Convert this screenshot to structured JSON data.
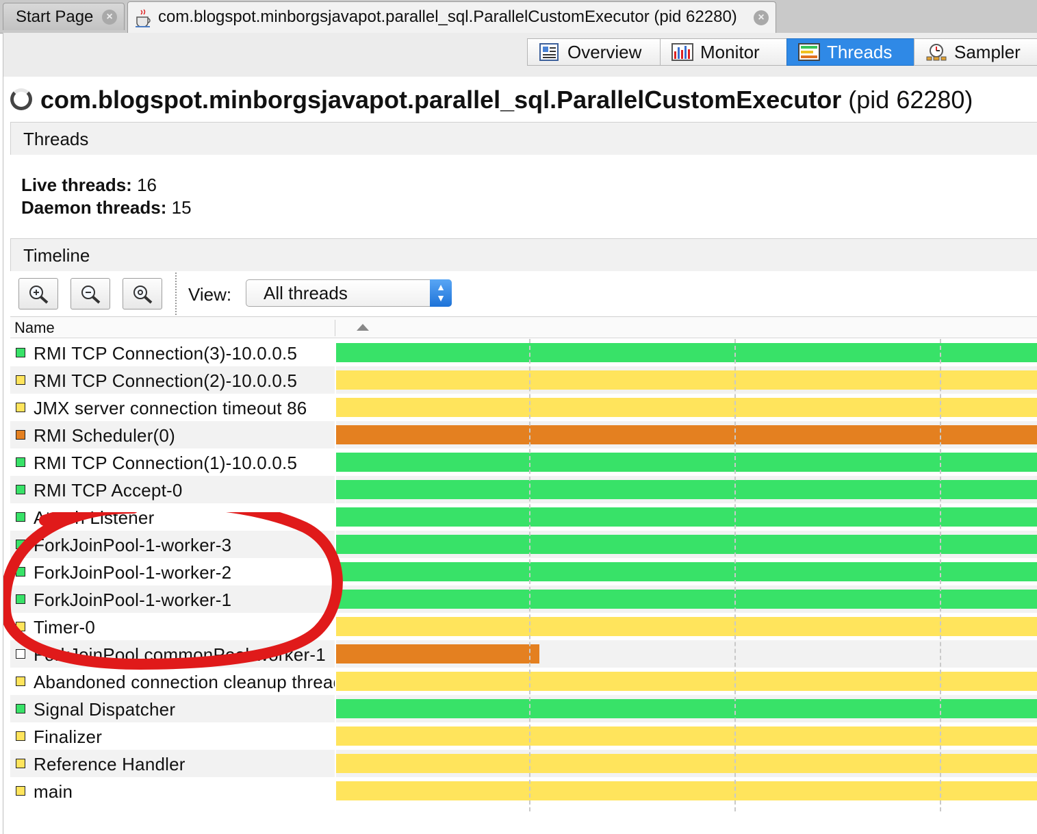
{
  "doc_tabs": [
    {
      "label": "Start Page",
      "active": false
    },
    {
      "label": "com.blogspot.minborgsjavapot.parallel_sql.ParallelCustomExecutor (pid 62280)",
      "active": true
    }
  ],
  "view_tabs": [
    {
      "label": "Overview",
      "icon": "overview-icon",
      "selected": false
    },
    {
      "label": "Monitor",
      "icon": "monitor-icon",
      "selected": false
    },
    {
      "label": "Threads",
      "icon": "threads-icon",
      "selected": true
    },
    {
      "label": "Sampler",
      "icon": "sampler-icon",
      "selected": false
    }
  ],
  "app": {
    "process_name": "com.blogspot.minborgsjavapot.parallel_sql.ParallelCustomExecutor",
    "pid_label": "(pid 62280)"
  },
  "threads_section": {
    "title": "Threads",
    "live_label": "Live threads:",
    "live_value": "16",
    "daemon_label": "Daemon threads:",
    "daemon_value": "15"
  },
  "timeline_section": {
    "title": "Timeline",
    "view_label": "View:",
    "view_selected": "All threads",
    "name_column": "Name"
  },
  "state_colors": {
    "running": "#38e268",
    "sleeping": "#ffe45c",
    "wait": "#e48020",
    "none": "#ffffff"
  },
  "threads": [
    {
      "name": "RMI TCP Connection(3)-10.0.0.5",
      "state": "running",
      "bar_fraction": 1.0
    },
    {
      "name": "RMI TCP Connection(2)-10.0.0.5",
      "state": "sleeping",
      "bar_fraction": 1.0
    },
    {
      "name": "JMX server connection timeout 86",
      "state": "sleeping",
      "bar_fraction": 1.0
    },
    {
      "name": "RMI Scheduler(0)",
      "state": "wait",
      "bar_fraction": 1.0
    },
    {
      "name": "RMI TCP Connection(1)-10.0.0.5",
      "state": "running",
      "bar_fraction": 1.0
    },
    {
      "name": "RMI TCP Accept-0",
      "state": "running",
      "bar_fraction": 1.0
    },
    {
      "name": "Attach Listener",
      "state": "running",
      "bar_fraction": 1.0
    },
    {
      "name": "ForkJoinPool-1-worker-3",
      "state": "running",
      "bar_fraction": 1.0
    },
    {
      "name": "ForkJoinPool-1-worker-2",
      "state": "running",
      "bar_fraction": 1.0
    },
    {
      "name": "ForkJoinPool-1-worker-1",
      "state": "running",
      "bar_fraction": 1.0
    },
    {
      "name": "Timer-0",
      "state": "sleeping",
      "bar_fraction": 1.0
    },
    {
      "name": "ForkJoinPool.commonPool-worker-1",
      "state": "none",
      "bar_state": "wait",
      "bar_fraction": 0.29
    },
    {
      "name": "Abandoned connection cleanup thread",
      "state": "sleeping",
      "bar_fraction": 1.0
    },
    {
      "name": "Signal Dispatcher",
      "state": "running",
      "bar_fraction": 1.0
    },
    {
      "name": "Finalizer",
      "state": "sleeping",
      "bar_fraction": 1.0
    },
    {
      "name": "Reference Handler",
      "state": "sleeping",
      "bar_fraction": 1.0
    },
    {
      "name": "main",
      "state": "sleeping",
      "bar_fraction": 1.0
    }
  ]
}
